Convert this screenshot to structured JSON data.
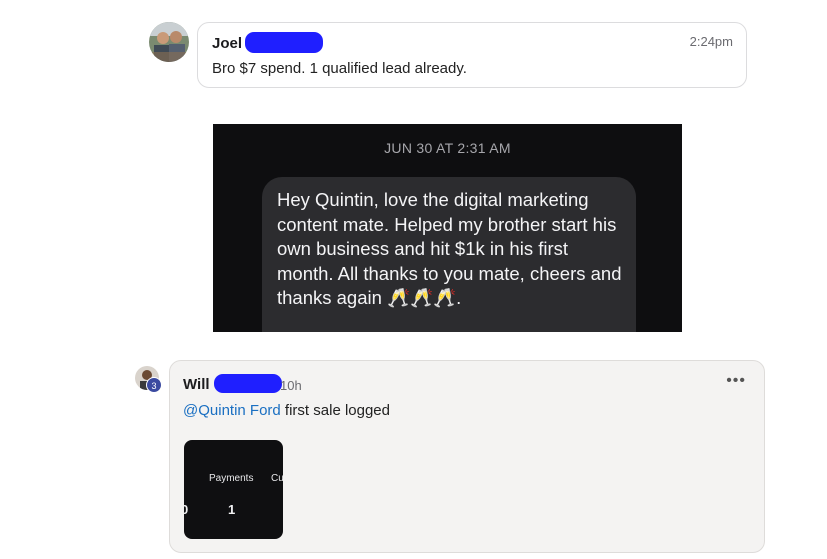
{
  "post1": {
    "author": "Joel",
    "time": "2:24pm",
    "text": "Bro $7 spend. 1 qualified lead already."
  },
  "screenshot": {
    "date": "JUN 30 AT 2:31 AM",
    "message": "Hey Quintin, love the digital marketing content mate. Helped my brother start his own business and hit $1k in his first month. All thanks to you mate, cheers and thanks again 🥂🥂🥂."
  },
  "post2": {
    "author": "Will",
    "time": "10h",
    "badge": "3",
    "more": "•••",
    "mention": "@Quintin Ford",
    "text": " first sale logged",
    "thumb": {
      "label1": "Payments",
      "label2": "Cu",
      "value0": "0",
      "value1": "1"
    }
  }
}
